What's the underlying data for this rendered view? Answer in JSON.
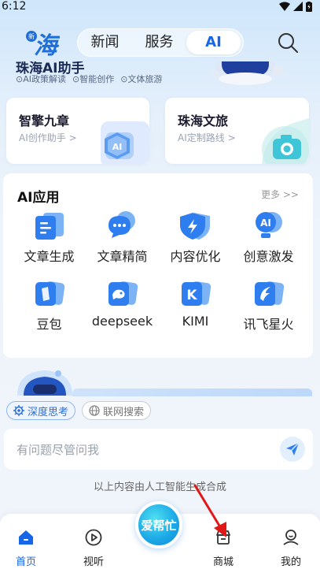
{
  "status_bar": {
    "time": "6:12"
  },
  "header": {
    "logo_text": "海",
    "tabs": [
      {
        "label": "新闻",
        "active": false
      },
      {
        "label": "服务",
        "active": false
      },
      {
        "label": "AI",
        "active": true
      }
    ]
  },
  "banner": {
    "title": "珠海AI助手",
    "tags": [
      "⊙AI政策解读",
      "⊙智能创作",
      "⊙文体旅游"
    ]
  },
  "cards": [
    {
      "title": "智擎九章",
      "subtitle": "AI创作助手 >"
    },
    {
      "title": "珠海文旅",
      "subtitle": "AI定制路线 >"
    }
  ],
  "ai_apps": {
    "title": "AI应用",
    "more": "更多 >>",
    "items": [
      {
        "label": "文章生成",
        "icon": "document-icon"
      },
      {
        "label": "文章精简",
        "icon": "chat-bubble-icon"
      },
      {
        "label": "内容优化",
        "icon": "lightning-shield-icon"
      },
      {
        "label": "创意激发",
        "icon": "ai-bulb-icon"
      },
      {
        "label": "豆包",
        "icon": "doubao-icon"
      },
      {
        "label": "deepseek",
        "icon": "deepseek-icon"
      },
      {
        "label": "KIMI",
        "icon": "kimi-icon"
      },
      {
        "label": "讯飞星火",
        "icon": "spark-icon"
      }
    ]
  },
  "chips": {
    "deep_think": "深度思考",
    "web_search": "联网搜索"
  },
  "input": {
    "placeholder": "有问题尽管问我"
  },
  "disclaimer": "以上内容由人工智能生成合成",
  "bottom_nav": {
    "home": "首页",
    "video": "视听",
    "center": "爱帮忙",
    "mall": "商城",
    "mine": "我的"
  },
  "colors": {
    "accent": "#1766e8",
    "icon_blue": "#2f7ef0",
    "background": "#eef4fb"
  }
}
